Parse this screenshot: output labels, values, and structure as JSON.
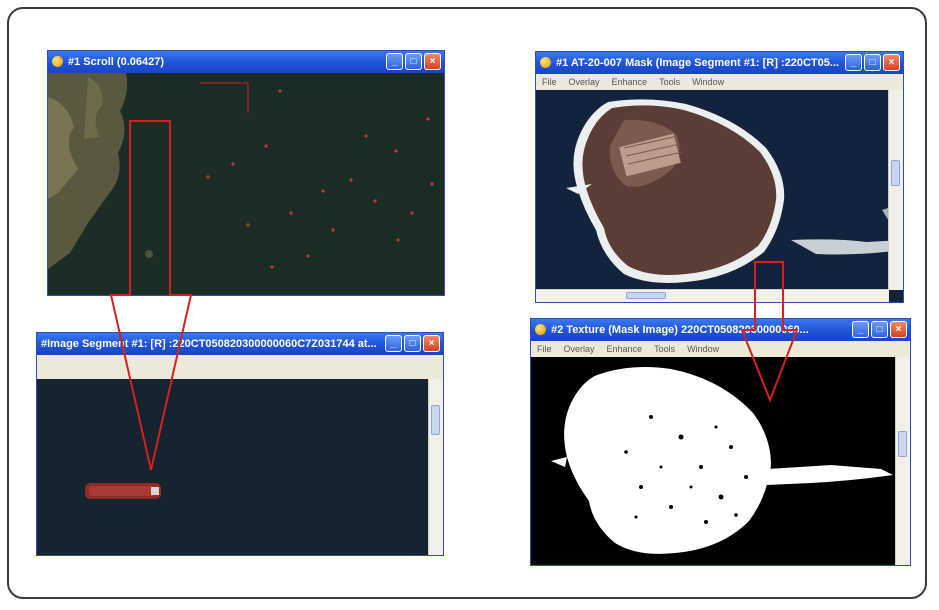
{
  "windows": {
    "scroll": {
      "title": "#1 Scroll (0.06427)"
    },
    "image_segment": {
      "title": "#Image Segment #1: [R] :220CT050820300000060C7Z031744 at..."
    },
    "island": {
      "title": "#1 AT-20-007 Mask (Image Segment #1: [R] :220CT05..."
    },
    "texture": {
      "title": "#2 Texture (Mask Image) 220CT05082030000060..."
    }
  },
  "menu_items": [
    "File",
    "Overlay",
    "Enhance",
    "Tools",
    "Window"
  ],
  "colors": {
    "titlebar": "#1f52d8",
    "annotation": "#d42020",
    "sea": "#16242a",
    "ship": "#8e2a28"
  }
}
